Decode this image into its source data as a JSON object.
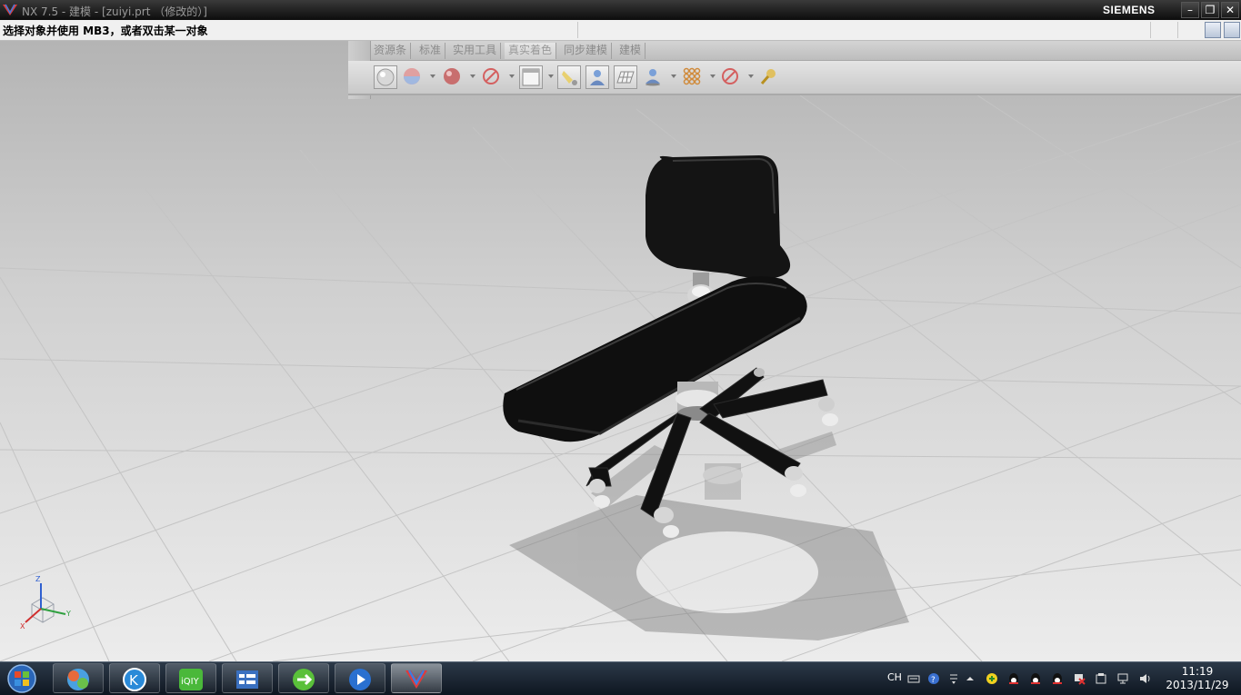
{
  "window": {
    "title": "NX 7.5 - 建模 - [zuiyi.prt （修改的）]",
    "brand": "SIEMENS",
    "controls": {
      "minimize": "–",
      "restore": "❐",
      "close": "✕"
    }
  },
  "cue_line": {
    "text": "选择对象并使用 MB3，或者双击某一对象"
  },
  "ribbon": {
    "tabs": [
      {
        "label": "资源条"
      },
      {
        "label": "标准"
      },
      {
        "label": "实用工具"
      },
      {
        "label": "真实着色"
      },
      {
        "label": "同步建模"
      },
      {
        "label": "建模"
      }
    ],
    "active_tab": "真实着色",
    "tools": [
      "sphere-material-icon",
      "background-icon",
      "red-sphere-icon",
      "no-entry-icon",
      "blank-panel-icon",
      "light-bulb-icon",
      "person-lighting-icon",
      "grid-floor-icon",
      "person-shadow-icon",
      "dots-pattern-icon",
      "no-entry-icon",
      "wrench-settings-icon"
    ]
  },
  "scene": {
    "model": "office-chair",
    "triad_axes": {
      "z": "Z",
      "y": "Y",
      "x": "X"
    }
  },
  "taskbar": {
    "apps": [
      "start-orb",
      "colorful-app-icon",
      "kugou-icon",
      "iqiyi-icon",
      "file-manager-icon",
      "sync-app-icon",
      "media-player-icon",
      "nx-app-icon"
    ],
    "tray": {
      "language": "CH"
    },
    "clock": {
      "time": "11:19",
      "date": "2013/11/29"
    }
  },
  "colors": {
    "accent": "#3a7bd5",
    "chair": "#111111",
    "metal": "#c0c0c0"
  }
}
